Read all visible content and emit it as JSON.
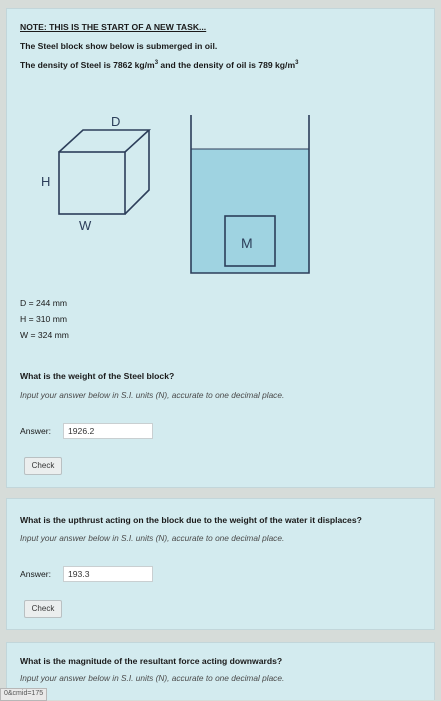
{
  "task": {
    "note": "NOTE: THIS IS THE START OF A NEW TASK...",
    "line1": "The Steel block show below is submerged in oil.",
    "line2_prefix": "The density of Steel is 7862 kg/m",
    "line2_mid": " and the density of oil is 789 kg/m",
    "superscript": "3"
  },
  "diagram": {
    "cube_label_d": "D",
    "cube_label_h": "H",
    "cube_label_w": "W",
    "tank_label_m": "M",
    "oil_color": "#9fd3e1",
    "line_color": "#2c3e5a"
  },
  "dimensions": {
    "d": "D = 244 mm",
    "h": "H = 310 mm",
    "w": "W = 324 mm"
  },
  "q1": {
    "question": "What is the weight of the Steel block?",
    "instruction": "Input your answer below in S.I. units (N), accurate to one decimal place.",
    "answer_label": "Answer:",
    "answer_value": "1926.2",
    "check_label": "Check"
  },
  "q2": {
    "question": "What is the upthrust acting on the block due to the weight of the water it displaces?",
    "instruction": "Input your answer below in S.I. units (N), accurate to one decimal place.",
    "answer_label": "Answer:",
    "answer_value": "193.3",
    "check_label": "Check"
  },
  "q3": {
    "question": "What is the magnitude of the resultant force acting downwards?",
    "instruction": "Input your answer below in S.I. units (N), accurate to one decimal place."
  },
  "status_bar": {
    "text": "0&cmid=175"
  }
}
